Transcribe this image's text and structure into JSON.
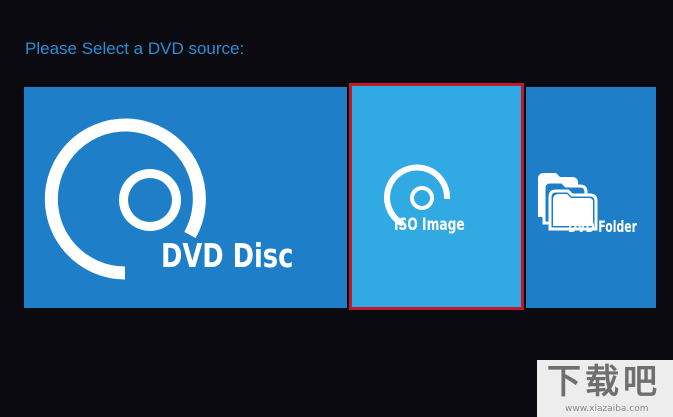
{
  "prompt": {
    "label": "Please Select a DVD source:"
  },
  "sources": {
    "disc": {
      "label": "DVD Disc"
    },
    "iso": {
      "label": "ISO Image"
    },
    "folder": {
      "label": "DVD Folder"
    }
  },
  "watermark": {
    "text": "下载吧",
    "sub": "www.xiazaiba.com"
  },
  "colors": {
    "background": "#0b0a10",
    "prompt_text": "#2a8fd6",
    "tile": "#1e7fc8",
    "tile_selected": "#31a9e2",
    "selection_border": "#c0182d",
    "icon": "#ffffff"
  },
  "icons": {
    "disc": "dvd-disc-icon",
    "iso": "iso-image-icon",
    "folder": "folder-stack-icon"
  }
}
